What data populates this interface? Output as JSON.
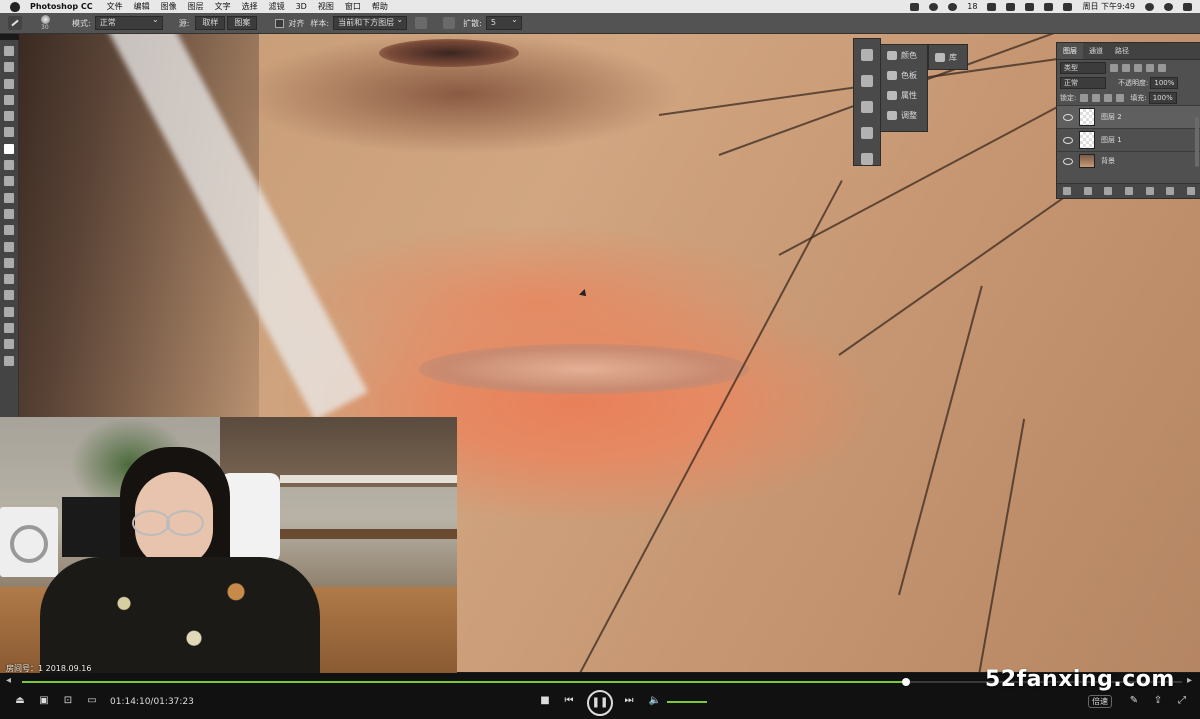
{
  "menubar": {
    "app_name": "Photoshop CC",
    "items": [
      "文件",
      "编辑",
      "图像",
      "图层",
      "文字",
      "选择",
      "滤镜",
      "3D",
      "视图",
      "窗口",
      "帮助"
    ],
    "battery": "18",
    "clock": "周日 下午9:49"
  },
  "options": {
    "brush_size": "30",
    "mode_label": "模式:",
    "mode_value": "正常",
    "source_label": "源:",
    "sample_btn": "取样",
    "pattern_btn": "图案",
    "aligned_label": "对齐",
    "sample_label": "样本:",
    "sample_value": "当前和下方图层",
    "diffusion_label": "扩散:",
    "diffusion_value": "5"
  },
  "dock": {
    "items": [
      {
        "label": "颜色",
        "icon": "color-wheel-icon"
      },
      {
        "label": "色板",
        "icon": "swatches-icon"
      },
      {
        "label": "属性",
        "icon": "properties-icon"
      },
      {
        "label": "调整",
        "icon": "adjustments-icon"
      }
    ],
    "library_label": "库"
  },
  "layers_panel": {
    "tabs": [
      "图层",
      "通道",
      "路径"
    ],
    "filter_value": "类型",
    "blend_mode": "正常",
    "opacity_label": "不透明度:",
    "opacity_value": "100%",
    "lock_label": "锁定:",
    "fill_label": "填充:",
    "fill_value": "100%",
    "layers": [
      {
        "name": "图层 2",
        "selected": true
      },
      {
        "name": "图层 1",
        "selected": false
      },
      {
        "name": "背景",
        "selected": false
      }
    ]
  },
  "webcam": {
    "caption": "房间号：1 2018.09.16"
  },
  "player": {
    "timecode": "01:14:10/01:37:23",
    "progress": 0.762,
    "volume": 0.6,
    "speed_label": "倍速",
    "accent": "#7acb3a"
  },
  "watermark": "52fanxing.com"
}
